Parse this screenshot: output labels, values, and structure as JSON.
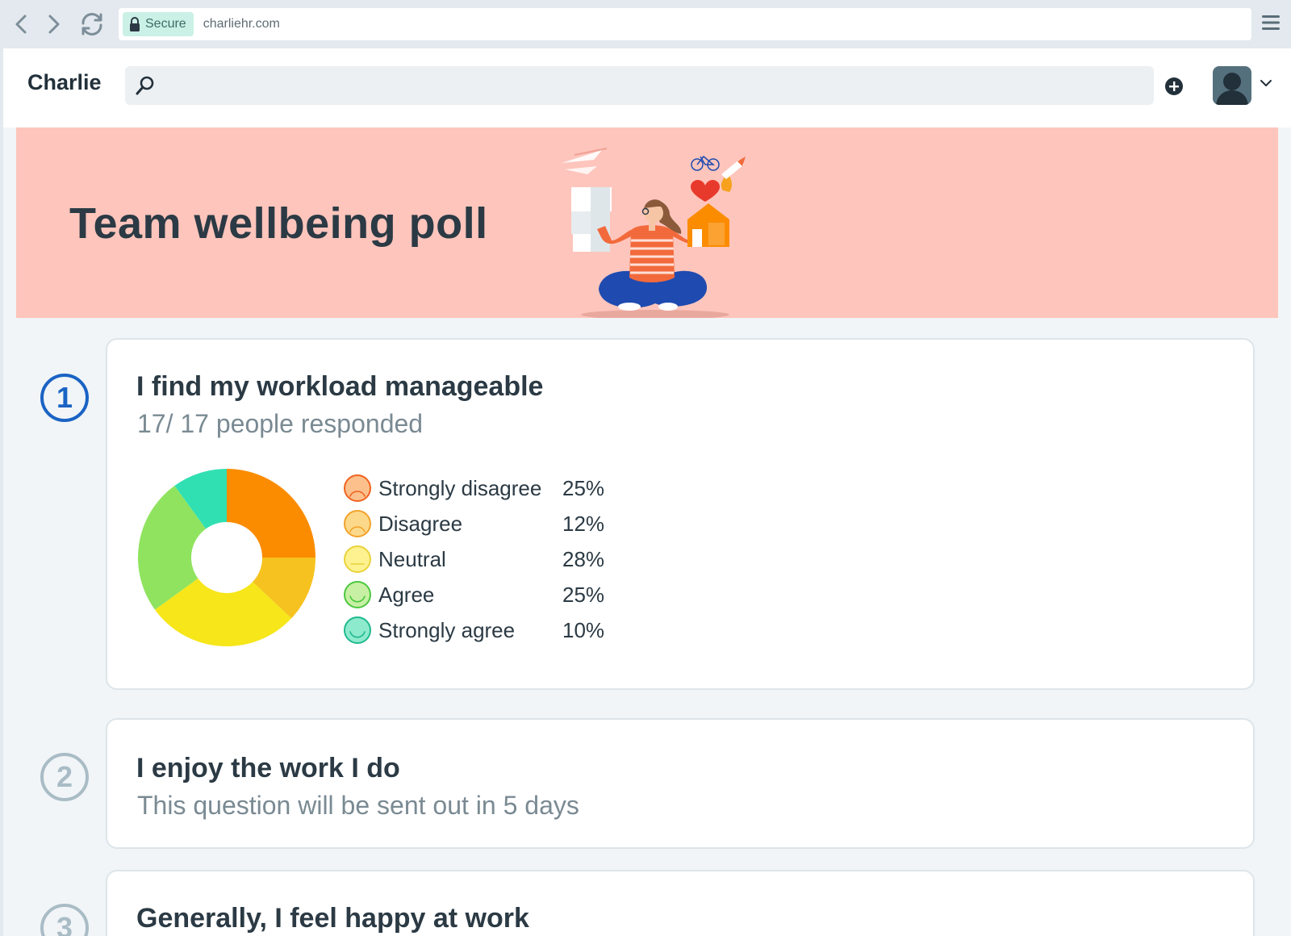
{
  "browser": {
    "secure_label": "Secure",
    "url": "charliehr.com"
  },
  "app": {
    "brand": "Charlie",
    "search": {
      "placeholder": ""
    }
  },
  "banner": {
    "title": "Team wellbeing poll"
  },
  "questions": [
    {
      "number": "1",
      "title": "I find my workload manageable",
      "subtitle": "17/ 17 people responded"
    },
    {
      "number": "2",
      "title": "I enjoy the work I do",
      "subtitle": "This question will be sent out in 5 days"
    },
    {
      "number": "3",
      "title": "Generally, I feel happy at work",
      "subtitle": ""
    }
  ],
  "chart_data": {
    "type": "pie",
    "donut": true,
    "categories": [
      "Strongly disagree",
      "Disagree",
      "Neutral",
      "Agree",
      "Strongly agree"
    ],
    "values": [
      25,
      12,
      28,
      25,
      10
    ],
    "value_labels": [
      "25%",
      "12%",
      "28%",
      "25%",
      "10%"
    ],
    "colors": [
      "#fb8c00",
      "#f6c21f",
      "#f6e61a",
      "#90e35f",
      "#31e0b2"
    ],
    "face_fills": [
      "#fcc08c",
      "#fcd98a",
      "#fdf28f",
      "#c7f0a4",
      "#8eeacd"
    ],
    "face_strokes": [
      "#f0631f",
      "#f2a22b",
      "#e9d23a",
      "#4cc83f",
      "#20b98e"
    ],
    "face_moods": [
      "sad",
      "sad",
      "neutral",
      "happy",
      "happy"
    ]
  }
}
